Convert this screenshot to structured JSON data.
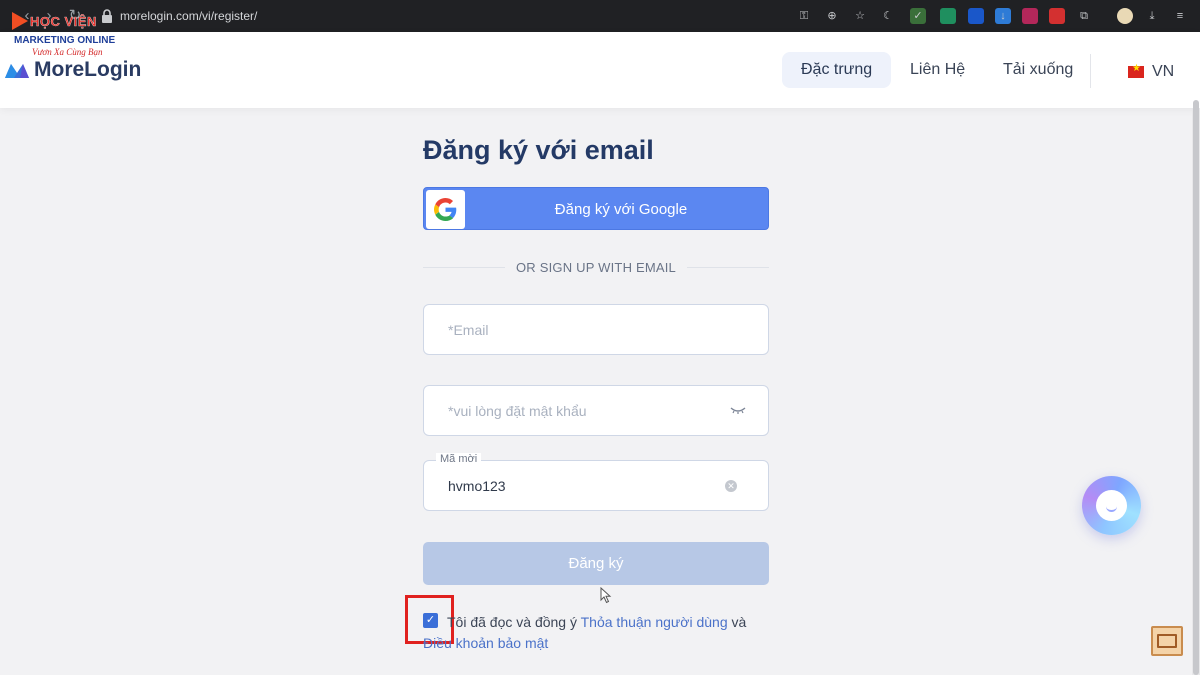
{
  "browser": {
    "url": "morelogin.com/vi/register",
    "url_display": "morelogin.com/vi/register/"
  },
  "watermark": {
    "line1": "HỌC VIỆN",
    "line2": "MARKETING ONLINE",
    "line3": "Vươn Xa Cùng Bạn"
  },
  "header": {
    "brand": "MoreLogin",
    "nav": [
      "Đặc trưng",
      "Liên Hệ",
      "Tải xuống"
    ],
    "active_nav": "Đặc trưng",
    "language": "VN"
  },
  "form": {
    "title": "Đăng ký với email",
    "google_button": "Đăng ký với Google",
    "divider": "OR SIGN UP WITH EMAIL",
    "email_placeholder": "*Email",
    "password_placeholder": "*vui lòng đặt mật khẩu",
    "invite_label": "Mã mời",
    "invite_value": "hvmo123",
    "submit": "Đăng ký",
    "agree_prefix": "Tôi đã đọc và đồng ý",
    "agree_link1": "Thỏa thuận người dùng",
    "agree_and": "và",
    "agree_link2": "Điều khoản bảo mật",
    "agree_checked": true
  },
  "colors": {
    "google_button": "#5b87f1",
    "submit_disabled": "#b7c8e6",
    "title": "#243a66",
    "link": "#4b72c9",
    "highlight_box": "#e0211f"
  },
  "icons": [
    "back-icon",
    "forward-icon",
    "reload-icon",
    "lock-icon",
    "google-icon",
    "eye-closed-icon",
    "clear-icon",
    "chat-icon",
    "vietnam-flag-icon"
  ]
}
